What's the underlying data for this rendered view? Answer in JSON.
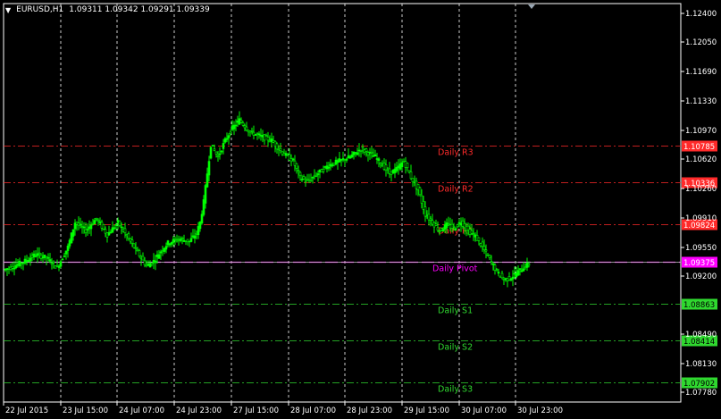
{
  "header": {
    "symbol": "EURUSD,H1",
    "ohlc": "1.09311 1.09342 1.09291 1.09339",
    "menu_glyph": "▼"
  },
  "colors": {
    "background": "#000000",
    "axis": "#ffffff",
    "grid": "#ffffff",
    "bull_candle": "#00ff00",
    "resistance": "#ff2a2a",
    "pivot": "#ff00ff",
    "support": "#2fd82f",
    "bid_line": "#c8c8c8"
  },
  "chart_data": {
    "type": "candlestick",
    "y_ticks": [
      "1.12400",
      "1.12050",
      "1.11690",
      "1.11330",
      "1.10970",
      "1.10620",
      "1.10260",
      "1.09910",
      "1.09550",
      "1.09200",
      "1.08490",
      "1.08130",
      "1.07780"
    ],
    "y_range": [
      1.0766,
      1.1252
    ],
    "x_ticks": [
      "22 Jul 2015",
      "23 Jul 15:00",
      "24 Jul 07:00",
      "24 Jul 23:00",
      "27 Jul 15:00",
      "28 Jul 07:00",
      "28 Jul 23:00",
      "29 Jul 15:00",
      "30 Jul 07:00",
      "30 Jul 23:00"
    ],
    "levels": [
      {
        "name": "Daily R3",
        "value": 1.10785,
        "tag": "1.10785",
        "kind": "resistance"
      },
      {
        "name": "Daily R2",
        "value": 1.10336,
        "tag": "1.10336",
        "kind": "resistance"
      },
      {
        "name": "Daily R1",
        "value": 1.09824,
        "tag": "1.09824",
        "kind": "resistance"
      },
      {
        "name": "Daily Pivot",
        "value": 1.09375,
        "tag": "1.09375",
        "kind": "pivot"
      },
      {
        "name": "Daily S1",
        "value": 1.08863,
        "tag": "1.08863",
        "kind": "support"
      },
      {
        "name": "Daily S2",
        "value": 1.08414,
        "tag": "1.08414",
        "kind": "support"
      },
      {
        "name": "Daily S3",
        "value": 1.07902,
        "tag": "1.07902",
        "kind": "support"
      }
    ],
    "price_path": [
      [
        0,
        1.0927
      ],
      [
        6,
        1.0932
      ],
      [
        12,
        1.0938
      ],
      [
        18,
        1.0946
      ],
      [
        24,
        1.0942
      ],
      [
        30,
        1.093
      ],
      [
        36,
        1.0955
      ],
      [
        40,
        1.0985
      ],
      [
        46,
        1.0975
      ],
      [
        52,
        1.099
      ],
      [
        58,
        1.097
      ],
      [
        64,
        1.0985
      ],
      [
        70,
        1.0965
      ],
      [
        76,
        1.0945
      ],
      [
        80,
        1.0932
      ],
      [
        84,
        1.0938
      ],
      [
        88,
        1.095
      ],
      [
        92,
        1.096
      ],
      [
        98,
        1.0965
      ],
      [
        104,
        1.0962
      ],
      [
        108,
        1.0972
      ],
      [
        110,
        1.0985
      ],
      [
        112,
        1.101
      ],
      [
        116,
        1.108
      ],
      [
        120,
        1.1065
      ],
      [
        124,
        1.1085
      ],
      [
        128,
        1.11
      ],
      [
        132,
        1.111
      ],
      [
        138,
        1.1095
      ],
      [
        144,
        1.109
      ],
      [
        150,
        1.1085
      ],
      [
        156,
        1.107
      ],
      [
        162,
        1.106
      ],
      [
        166,
        1.104
      ],
      [
        170,
        1.1035
      ],
      [
        176,
        1.1045
      ],
      [
        182,
        1.1055
      ],
      [
        188,
        1.106
      ],
      [
        194,
        1.1065
      ],
      [
        200,
        1.1075
      ],
      [
        204,
        1.107
      ],
      [
        208,
        1.1065
      ],
      [
        212,
        1.1055
      ],
      [
        216,
        1.1045
      ],
      [
        220,
        1.105
      ],
      [
        224,
        1.106
      ],
      [
        228,
        1.104
      ],
      [
        232,
        1.1025
      ],
      [
        236,
        1.0995
      ],
      [
        240,
        1.0985
      ],
      [
        244,
        1.0975
      ],
      [
        248,
        1.0982
      ],
      [
        252,
        1.0978
      ],
      [
        256,
        1.0986
      ],
      [
        260,
        1.0975
      ],
      [
        264,
        1.0968
      ],
      [
        268,
        1.0955
      ],
      [
        272,
        1.094
      ],
      [
        276,
        1.0925
      ],
      [
        280,
        1.0915
      ],
      [
        284,
        1.0918
      ],
      [
        288,
        1.0925
      ],
      [
        292,
        1.0932
      ],
      [
        294,
        1.0934
      ]
    ]
  }
}
